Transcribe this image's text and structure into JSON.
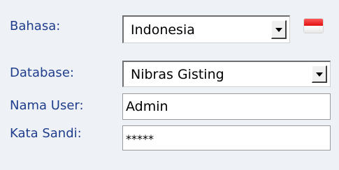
{
  "login_form": {
    "language": {
      "label": "Bahasa:",
      "selected": "Indonesia",
      "flag_icon": "indonesia-flag-icon",
      "flag_colors": [
        "#e01010",
        "#ffffff"
      ]
    },
    "database": {
      "label": "Database:",
      "selected": "Nibras Gisting"
    },
    "username": {
      "label": "Nama User:",
      "value": "Admin"
    },
    "password": {
      "label": "Kata Sandi:",
      "value": "*****"
    }
  },
  "colors": {
    "label_text": "#1f3d8c",
    "background": "#eef2f7"
  }
}
